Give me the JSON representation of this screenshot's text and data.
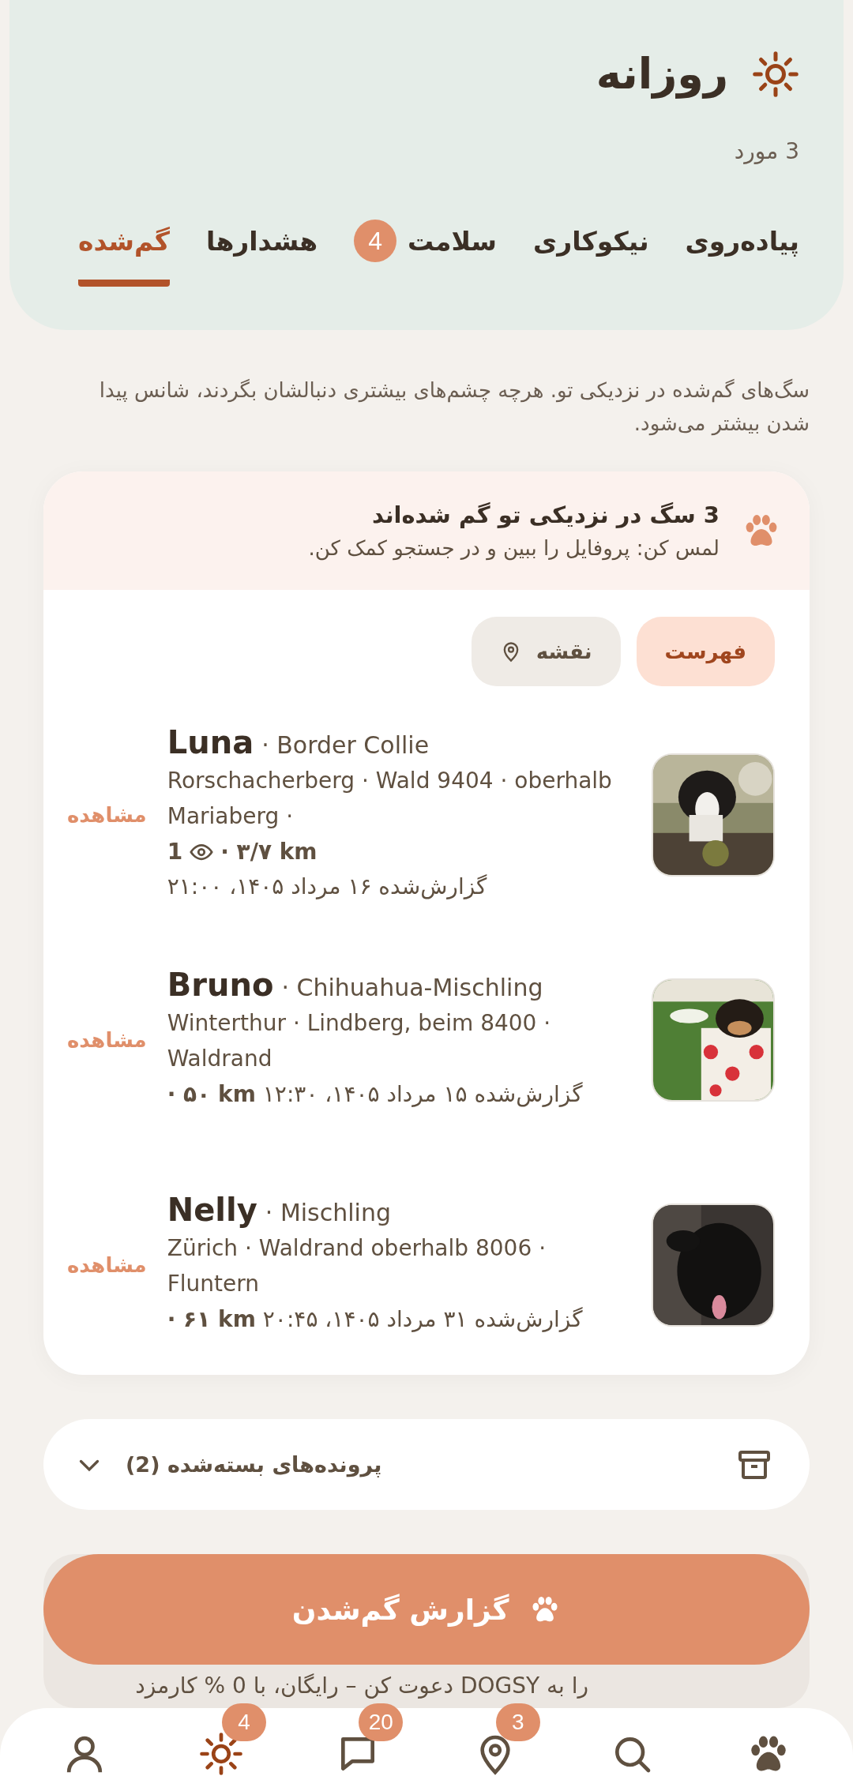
{
  "header": {
    "title": "روزانه",
    "count": "3 مورد"
  },
  "tabs": [
    {
      "label": "پیاده‌روی",
      "selected": false
    },
    {
      "label": "نیکوکاری",
      "selected": false
    },
    {
      "label": "سلامت",
      "selected": false,
      "badge": "4"
    },
    {
      "label": "هشدارها",
      "selected": false
    },
    {
      "label": "گم‌شده",
      "selected": true
    }
  ],
  "intro": "سگ‌های گم‌شده در نزدیکی تو. هرچه چشم‌های بیشتری دنبالشان بگردند، شانس پیدا شدن بیشتر می‌شود.",
  "lost_card": {
    "title": "3 سگ در نزدیکی تو گم شده‌اند",
    "subtitle": "لمس کن: پروفایل را ببین و در جستجو کمک کن.",
    "views": [
      {
        "kind": "list",
        "label": "فهرست",
        "selected": true
      },
      {
        "kind": "map",
        "label": "نقشه",
        "selected": false
      }
    ],
    "dogs": [
      {
        "name": "Luna",
        "breed": "· Border Collie",
        "location": "Rorschacherberg · Wald 9404 · oberhalb Mariaberg ·",
        "views": "1",
        "distance": "· ۳/۷ km",
        "reported": "گزارش‌شده ۱۶ مرداد ۱۴۰۵، ۲۱:۰۰",
        "action": "مشاهده"
      },
      {
        "name": "Bruno",
        "breed": "· Chihuahua-Mischling",
        "location": "Winterthur · Lindberg, beim 8400 · Waldrand",
        "distance": "· ۵۰ km",
        "reported": "گزارش‌شده ۱۵ مرداد ۱۴۰۵، ۱۲:۳۰",
        "action": "مشاهده"
      },
      {
        "name": "Nelly",
        "breed": "· Mischling",
        "location": "Zürich · Waldrand oberhalb 8006 · Fluntern",
        "distance": "· ۶۱ km",
        "reported": "گزارش‌شده ۳۱ مرداد ۱۴۰۵، ۲۰:۴۵",
        "action": "مشاهده"
      }
    ]
  },
  "closed_cases": {
    "label": "پرونده‌های بسته‌شده (2)",
    "expanded": false
  },
  "report_button": "گزارش گم‌شدن",
  "invite_text": "را به DOGSY دعوت کن – رایگان، با 0 % کارمزد",
  "nav": [
    {
      "kind": "paw",
      "selected": false
    },
    {
      "kind": "search",
      "selected": false
    },
    {
      "kind": "pin",
      "selected": false,
      "badge": "3"
    },
    {
      "kind": "chat",
      "selected": false,
      "badge": "20"
    },
    {
      "kind": "sun",
      "selected": true,
      "badge": "4"
    },
    {
      "kind": "user",
      "selected": false
    }
  ]
}
